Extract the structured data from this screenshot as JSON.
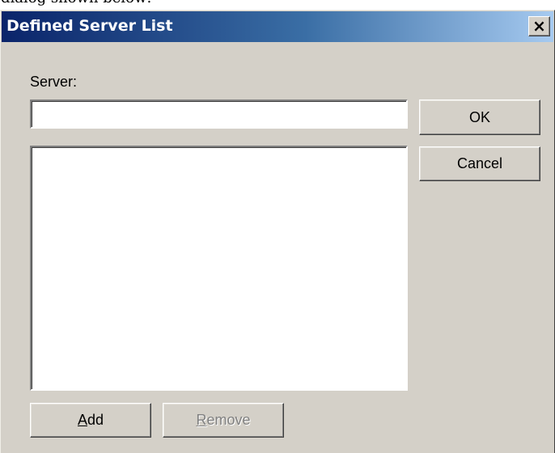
{
  "page": {
    "caption": "dialog shown below:"
  },
  "dialog": {
    "title": "Defined Server List",
    "close_symbol": "×",
    "server_label": "Server:",
    "server_value": "",
    "server_list_items": [],
    "buttons": {
      "ok": "OK",
      "cancel": "Cancel",
      "add_mnemonic": "A",
      "add_rest": "dd",
      "remove_mnemonic": "R",
      "remove_rest": "emove"
    }
  },
  "colors": {
    "dialog_face": "#d4d0c8",
    "title_gradient_start": "#0a246a",
    "title_gradient_end": "#a6caf0",
    "disabled_text": "#808080"
  },
  "icons": {
    "close": "close-icon"
  }
}
